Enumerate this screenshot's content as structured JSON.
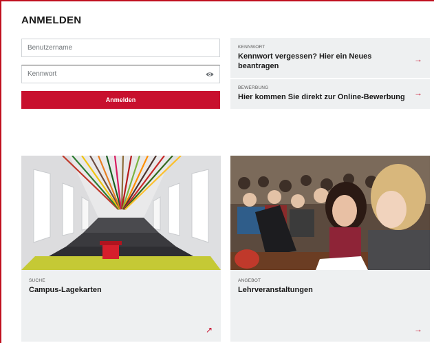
{
  "login": {
    "title": "ANMELDEN",
    "username_placeholder": "Benutzername",
    "password_placeholder": "Kennwort",
    "submit_label": "Anmelden"
  },
  "links": [
    {
      "kicker": "KENNWORT",
      "title": "Kennwort vergessen? Hier ein Neues beantragen",
      "arrow": "→"
    },
    {
      "kicker": "BEWERBUNG",
      "title": "Hier kommen Sie direkt zur Online-Bewerbung",
      "arrow": "→"
    }
  ],
  "tiles": [
    {
      "kicker": "SUCHE",
      "title": "Campus-Lagekarten",
      "arrow": "↗"
    },
    {
      "kicker": "ANGEBOT",
      "title": "Lehrveranstaltungen",
      "arrow": "→"
    }
  ],
  "colors": {
    "accent": "#c8102e",
    "card_bg": "#eef0f1"
  }
}
